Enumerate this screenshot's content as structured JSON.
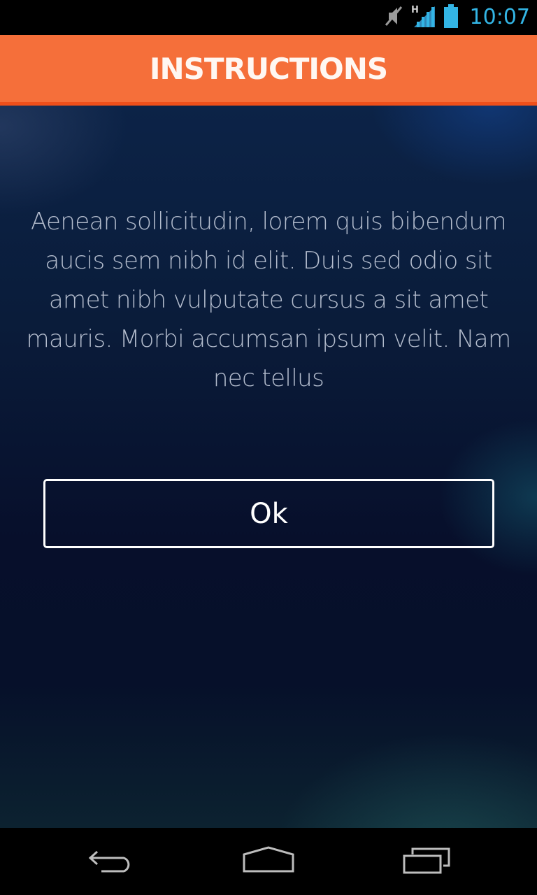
{
  "status_bar": {
    "time": "10:07",
    "icons": [
      "muted-icon",
      "signal-h-icon",
      "battery-icon"
    ],
    "time_color": "#33b5e5"
  },
  "header": {
    "title": "INSTRUCTIONS",
    "color": "#f56f3a"
  },
  "main": {
    "instructions_text": "Aenean sollicitudin, lorem quis bibendum aucis sem nibh id elit. Duis sed odio sit amet nibh vulputate cursus a sit amet mauris. Morbi accumsan ipsum velit. Nam nec tellus",
    "ok_button_label": "Ok"
  },
  "nav_bar": {
    "buttons": [
      "back-icon",
      "home-icon",
      "recent-apps-icon"
    ]
  }
}
